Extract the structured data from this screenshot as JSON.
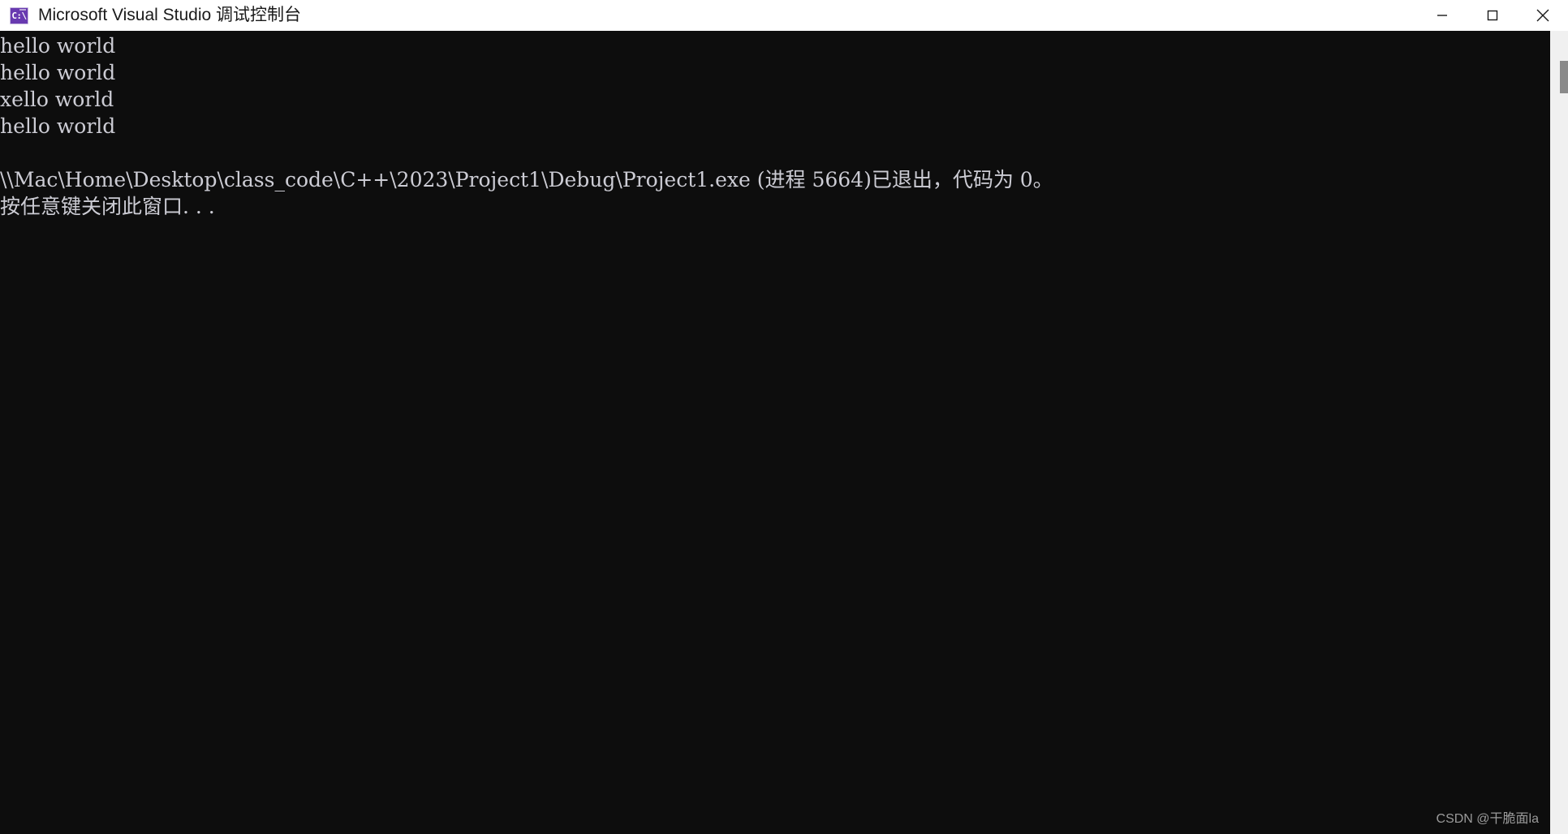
{
  "window": {
    "title": "Microsoft Visual Studio 调试控制台",
    "icon_name": "console-app-icon",
    "icon_glyph": "C:\\",
    "titlebar_background": "#ffffff",
    "titlebar_text_color": "#1a1a1a",
    "controls": {
      "minimize_label": "最小化",
      "maximize_label": "最大化",
      "close_label": "关闭"
    }
  },
  "console": {
    "background": "#0d0d0d",
    "foreground": "#ccccd4",
    "lines": [
      "hello world",
      "hello world",
      "xello world",
      "hello world",
      "",
      "\\\\Mac\\Home\\Desktop\\class_code\\C++\\2023\\Project1\\Debug\\Project1.exe (进程 5664)已退出，代码为 0。",
      "按任意键关闭此窗口. . ."
    ],
    "exit_code": "0",
    "process_id": "5664",
    "executable_path": "\\\\Mac\\Home\\Desktop\\class_code\\C++\\2023\\Project1\\Debug\\Project1.exe"
  },
  "scrollbar": {
    "track_color": "#f0f0f0",
    "thumb_color": "#8a8a8a"
  },
  "watermark": {
    "text": "CSDN @干脆面la"
  }
}
